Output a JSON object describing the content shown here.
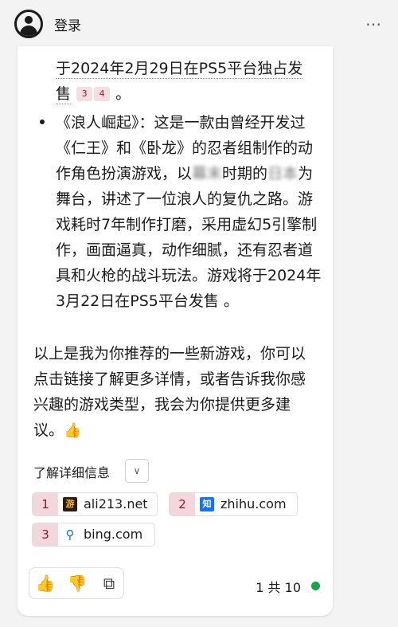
{
  "header": {
    "login_label": "登录",
    "more_icon": "⋯"
  },
  "message": {
    "item1_tail_line1": "于2024年2月29日在PS5平台独占发",
    "item1_tail_line2_a": "售",
    "item1_tail_line2_b": "。",
    "item1_citations": [
      "3",
      "4"
    ],
    "item2_prefix": "《浪人崛起》：这是一款由曾经开发过《仁王》和《卧龙》的忍者组制作的动作角色扮演游戏，以",
    "item2_blur1": "幕末",
    "item2_mid": "时期的",
    "item2_blur2": "日本",
    "item2_suffix": "为舞台，讲述了一位浪人的复仇之路。游戏耗时7年制作打磨，采用虚幻5引擎制作，画面逼真，动作细腻，还有忍者道具和火枪的战斗玩法。游戏将于2024年3月22日在PS5平台发售 。",
    "summary": "以上是我为你推荐的一些新游戏，你可以点击链接了解更多详情，或者告诉我你感兴趣的游戏类型，我会为你提供更多建议。",
    "summary_emoji": "👍"
  },
  "learn_more": {
    "label": "了解详细信息",
    "toggle_icon": "∨"
  },
  "sources": [
    {
      "num": "1",
      "label": "ali213.net",
      "icon": "游"
    },
    {
      "num": "2",
      "label": "zhihu.com",
      "icon": "知"
    },
    {
      "num": "3",
      "label": "bing.com",
      "icon": "⚲"
    }
  ],
  "actions": {
    "like_icon": "👍",
    "dislike_icon": "👎",
    "copy_icon": "⧉"
  },
  "pagination": {
    "label": "1 共 10"
  }
}
